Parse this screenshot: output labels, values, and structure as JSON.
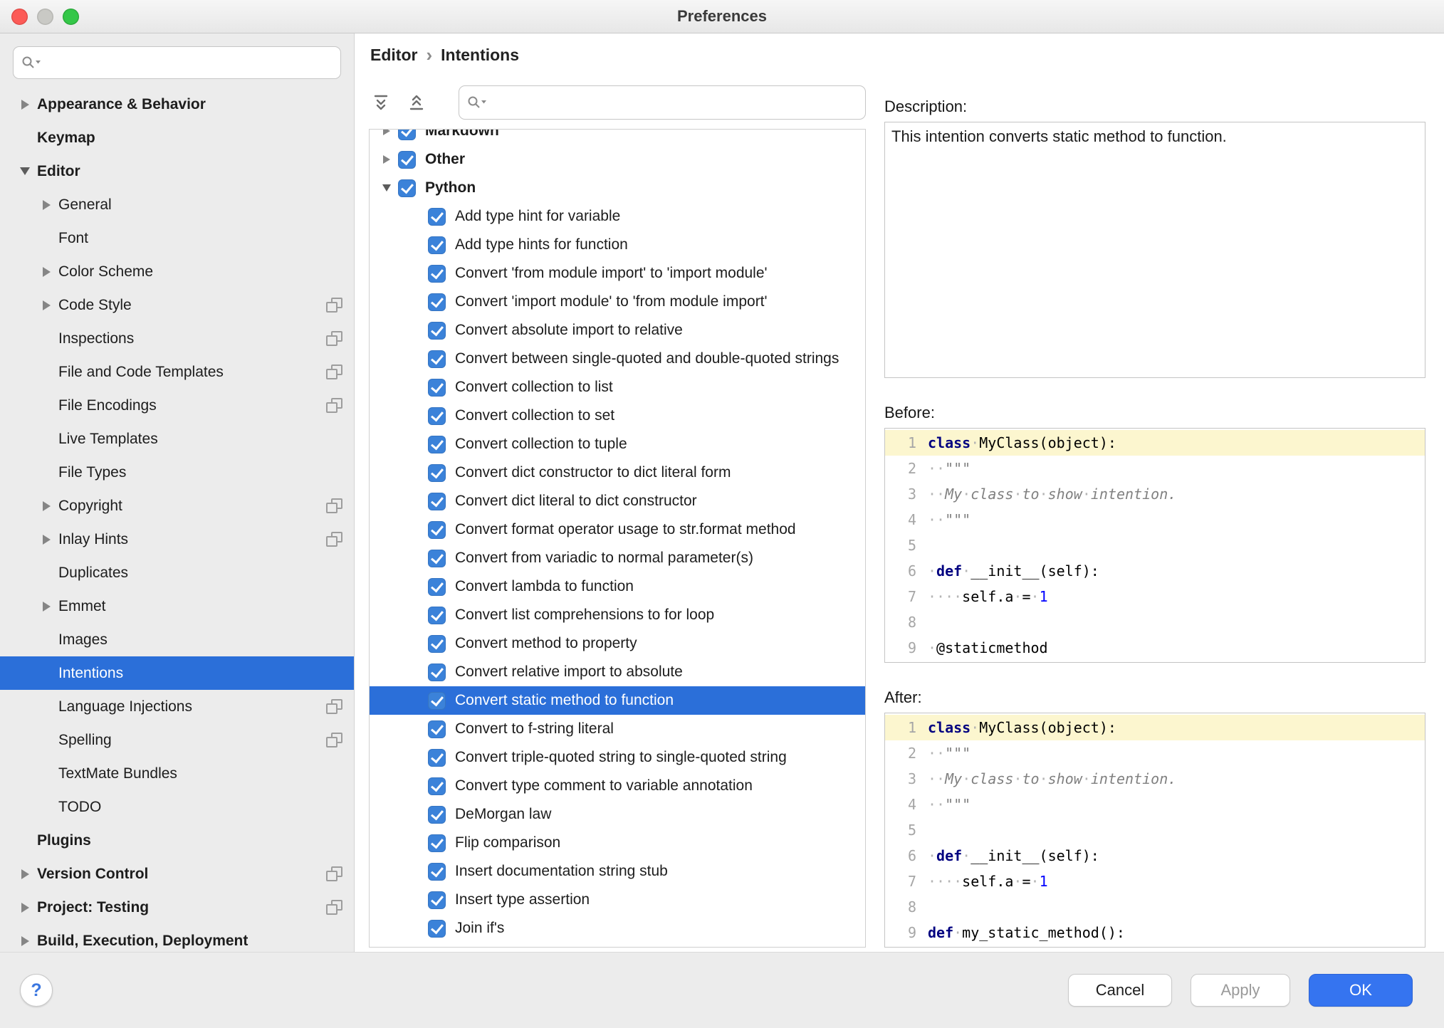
{
  "colors": {
    "selection": "#2b6fd9",
    "checkbox": "#3b82d9",
    "ok": "#3574f0",
    "line-highlight": "#fcf6cf",
    "close": "#fc5b57",
    "minimize": "#c9c9c5",
    "zoom": "#34c748"
  },
  "window": {
    "title": "Preferences"
  },
  "sidebar": {
    "search": {
      "placeholder": ""
    },
    "items": [
      {
        "label": "Appearance & Behavior",
        "level": 0,
        "bold": true,
        "arrow": "collapsed"
      },
      {
        "label": "Keymap",
        "level": 0,
        "bold": true
      },
      {
        "label": "Editor",
        "level": 0,
        "bold": true,
        "arrow": "expanded"
      },
      {
        "label": "General",
        "level": 1,
        "arrow": "collapsed"
      },
      {
        "label": "Font",
        "level": 1
      },
      {
        "label": "Color Scheme",
        "level": 1,
        "arrow": "collapsed"
      },
      {
        "label": "Code Style",
        "level": 1,
        "arrow": "collapsed",
        "shared_icon": true
      },
      {
        "label": "Inspections",
        "level": 1,
        "shared_icon": true
      },
      {
        "label": "File and Code Templates",
        "level": 1,
        "shared_icon": true
      },
      {
        "label": "File Encodings",
        "level": 1,
        "shared_icon": true
      },
      {
        "label": "Live Templates",
        "level": 1
      },
      {
        "label": "File Types",
        "level": 1
      },
      {
        "label": "Copyright",
        "level": 1,
        "arrow": "collapsed",
        "shared_icon": true
      },
      {
        "label": "Inlay Hints",
        "level": 1,
        "arrow": "collapsed",
        "shared_icon": true
      },
      {
        "label": "Duplicates",
        "level": 1
      },
      {
        "label": "Emmet",
        "level": 1,
        "arrow": "collapsed"
      },
      {
        "label": "Images",
        "level": 1
      },
      {
        "label": "Intentions",
        "level": 1,
        "selected": true
      },
      {
        "label": "Language Injections",
        "level": 1,
        "shared_icon": true
      },
      {
        "label": "Spelling",
        "level": 1,
        "shared_icon": true
      },
      {
        "label": "TextMate Bundles",
        "level": 1
      },
      {
        "label": "TODO",
        "level": 1
      },
      {
        "label": "Plugins",
        "level": 0,
        "bold": true
      },
      {
        "label": "Version Control",
        "level": 0,
        "bold": true,
        "arrow": "collapsed",
        "shared_icon": true
      },
      {
        "label": "Project: Testing",
        "level": 0,
        "bold": true,
        "arrow": "collapsed",
        "shared_icon": true
      },
      {
        "label": "Build, Execution, Deployment",
        "level": 0,
        "bold": true,
        "arrow": "collapsed"
      }
    ]
  },
  "breadcrumb": {
    "parent": "Editor",
    "separator": "›",
    "current": "Intentions"
  },
  "intentions_panel": {
    "toolbar": {
      "expand_icon": "expand-all",
      "collapse_icon": "collapse-all"
    },
    "search": {
      "placeholder": ""
    },
    "tree": [
      {
        "label": "Markdown",
        "type": "group",
        "arrow": "collapsed",
        "checked": true,
        "clipped": true
      },
      {
        "label": "Other",
        "type": "group",
        "arrow": "collapsed",
        "checked": true
      },
      {
        "label": "Python",
        "type": "group",
        "arrow": "expanded",
        "checked": true
      },
      {
        "label": "Add type hint for variable",
        "type": "item",
        "checked": true
      },
      {
        "label": "Add type hints for function",
        "type": "item",
        "checked": true
      },
      {
        "label": "Convert 'from module import' to 'import module'",
        "type": "item",
        "checked": true
      },
      {
        "label": "Convert 'import module' to 'from module import'",
        "type": "item",
        "checked": true
      },
      {
        "label": "Convert absolute import to relative",
        "type": "item",
        "checked": true
      },
      {
        "label": "Convert between single-quoted and double-quoted strings",
        "type": "item",
        "checked": true
      },
      {
        "label": "Convert collection to list",
        "type": "item",
        "checked": true
      },
      {
        "label": "Convert collection to set",
        "type": "item",
        "checked": true
      },
      {
        "label": "Convert collection to tuple",
        "type": "item",
        "checked": true
      },
      {
        "label": "Convert dict constructor to dict literal form",
        "type": "item",
        "checked": true
      },
      {
        "label": "Convert dict literal to dict constructor",
        "type": "item",
        "checked": true
      },
      {
        "label": "Convert format operator usage to str.format method",
        "type": "item",
        "checked": true
      },
      {
        "label": "Convert from variadic to normal parameter(s)",
        "type": "item",
        "checked": true
      },
      {
        "label": "Convert lambda to function",
        "type": "item",
        "checked": true
      },
      {
        "label": "Convert list comprehensions to for loop",
        "type": "item",
        "checked": true
      },
      {
        "label": "Convert method to property",
        "type": "item",
        "checked": true
      },
      {
        "label": "Convert relative import to absolute",
        "type": "item",
        "checked": true
      },
      {
        "label": "Convert static method to function",
        "type": "item",
        "checked": true,
        "selected": true
      },
      {
        "label": "Convert to f-string literal",
        "type": "item",
        "checked": true
      },
      {
        "label": "Convert triple-quoted string to single-quoted string",
        "type": "item",
        "checked": true
      },
      {
        "label": "Convert type comment to variable annotation",
        "type": "item",
        "checked": true
      },
      {
        "label": "DeMorgan law",
        "type": "item",
        "checked": true
      },
      {
        "label": "Flip comparison",
        "type": "item",
        "checked": true
      },
      {
        "label": "Insert documentation string stub",
        "type": "item",
        "checked": true
      },
      {
        "label": "Insert type assertion",
        "type": "item",
        "checked": true
      },
      {
        "label": "Join if's",
        "type": "item",
        "checked": true
      }
    ]
  },
  "description": {
    "label": "Description:",
    "text": "This intention converts static method to function."
  },
  "before": {
    "label": "Before:",
    "lines": [
      {
        "hl": true,
        "tokens": [
          [
            "kw",
            "class"
          ],
          [
            "ws",
            "·"
          ],
          [
            "pl",
            "MyClass(object):"
          ]
        ]
      },
      {
        "tokens": [
          [
            "ws",
            "··"
          ],
          [
            "doc",
            "\"\"\""
          ]
        ]
      },
      {
        "tokens": [
          [
            "ws",
            "··"
          ],
          [
            "doc",
            "My"
          ],
          [
            "ws",
            "·"
          ],
          [
            "doc",
            "class"
          ],
          [
            "ws",
            "·"
          ],
          [
            "doc",
            "to"
          ],
          [
            "ws",
            "·"
          ],
          [
            "doc",
            "show"
          ],
          [
            "ws",
            "·"
          ],
          [
            "doc",
            "intention."
          ]
        ]
      },
      {
        "tokens": [
          [
            "ws",
            "··"
          ],
          [
            "doc",
            "\"\"\""
          ]
        ]
      },
      {
        "tokens": []
      },
      {
        "tokens": [
          [
            "ws",
            "·"
          ],
          [
            "kw",
            "def"
          ],
          [
            "ws",
            "·"
          ],
          [
            "pl",
            "__init__(self):"
          ]
        ]
      },
      {
        "tokens": [
          [
            "ws",
            "····"
          ],
          [
            "pl",
            "self.a"
          ],
          [
            "ws",
            "·"
          ],
          [
            "pl",
            "="
          ],
          [
            "ws",
            "·"
          ],
          [
            "num",
            "1"
          ]
        ]
      },
      {
        "tokens": []
      },
      {
        "tokens": [
          [
            "ws",
            "·"
          ],
          [
            "pl",
            "@staticmethod"
          ]
        ]
      }
    ]
  },
  "after": {
    "label": "After:",
    "lines": [
      {
        "hl": true,
        "tokens": [
          [
            "kw",
            "class"
          ],
          [
            "ws",
            "·"
          ],
          [
            "pl",
            "MyClass(object):"
          ]
        ]
      },
      {
        "tokens": [
          [
            "ws",
            "··"
          ],
          [
            "doc",
            "\"\"\""
          ]
        ]
      },
      {
        "tokens": [
          [
            "ws",
            "··"
          ],
          [
            "doc",
            "My"
          ],
          [
            "ws",
            "·"
          ],
          [
            "doc",
            "class"
          ],
          [
            "ws",
            "·"
          ],
          [
            "doc",
            "to"
          ],
          [
            "ws",
            "·"
          ],
          [
            "doc",
            "show"
          ],
          [
            "ws",
            "·"
          ],
          [
            "doc",
            "intention."
          ]
        ]
      },
      {
        "tokens": [
          [
            "ws",
            "··"
          ],
          [
            "doc",
            "\"\"\""
          ]
        ]
      },
      {
        "tokens": []
      },
      {
        "tokens": [
          [
            "ws",
            "·"
          ],
          [
            "kw",
            "def"
          ],
          [
            "ws",
            "·"
          ],
          [
            "pl",
            "__init__(self):"
          ]
        ]
      },
      {
        "tokens": [
          [
            "ws",
            "····"
          ],
          [
            "pl",
            "self.a"
          ],
          [
            "ws",
            "·"
          ],
          [
            "pl",
            "="
          ],
          [
            "ws",
            "·"
          ],
          [
            "num",
            "1"
          ]
        ]
      },
      {
        "tokens": []
      },
      {
        "tokens": [
          [
            "kw",
            "def"
          ],
          [
            "ws",
            "·"
          ],
          [
            "pl",
            "my_static_method():"
          ]
        ]
      }
    ]
  },
  "footer": {
    "help": "?",
    "cancel": "Cancel",
    "apply": "Apply",
    "ok": "OK"
  }
}
